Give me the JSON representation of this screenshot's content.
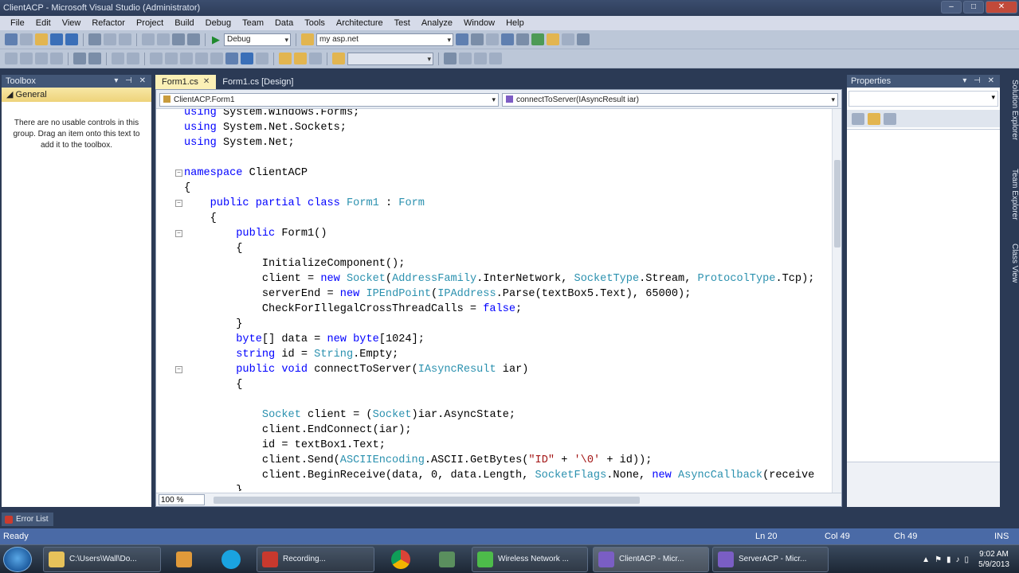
{
  "window": {
    "title": "ClientACP - Microsoft Visual Studio (Administrator)"
  },
  "menu": [
    "File",
    "Edit",
    "View",
    "Refactor",
    "Project",
    "Build",
    "Debug",
    "Team",
    "Data",
    "Tools",
    "Architecture",
    "Test",
    "Analyze",
    "Window",
    "Help"
  ],
  "toolbar": {
    "config": "Debug",
    "search": "my asp.net"
  },
  "toolbox": {
    "title": "Toolbox",
    "group": "General",
    "message": "There are no usable controls in this group. Drag an item onto this text to add it to the toolbox."
  },
  "tabs": [
    {
      "label": "Form1.cs",
      "active": true
    },
    {
      "label": "Form1.cs [Design]",
      "active": false
    }
  ],
  "nav": {
    "type": "ClientACP.Form1",
    "member": "connectToServer(IAsyncResult iar)"
  },
  "code": {
    "lines": [
      "using System.Windows.Forms;",
      "using System.Net.Sockets;",
      "using System.Net;",
      "",
      "namespace ClientACP",
      "{",
      "    public partial class Form1 : Form",
      "    {",
      "        public Form1()",
      "        {",
      "            InitializeComponent();",
      "            client = new Socket(AddressFamily.InterNetwork, SocketType.Stream, ProtocolType.Tcp);",
      "            serverEnd = new IPEndPoint(IPAddress.Parse(textBox5.Text), 65000);",
      "            CheckForIllegalCrossThreadCalls = false;",
      "        }",
      "        byte[] data = new byte[1024];",
      "        string id = String.Empty;",
      "        public void connectToServer(IAsyncResult iar)",
      "        {",
      "",
      "            Socket client = (Socket)iar.AsyncState;",
      "            client.EndConnect(iar);",
      "            id = textBox1.Text;",
      "            client.Send(ASCIIEncoding.ASCII.GetBytes(\"ID\" + '\\0' + id));",
      "            client.BeginReceive(data, 0, data.Length, SocketFlags.None, new AsyncCallback(receive",
      "        }"
    ]
  },
  "zoom": "100 %",
  "properties": {
    "title": "Properties"
  },
  "sidetabs": [
    "Solution Explorer",
    "Team Explorer",
    "Class View"
  ],
  "error_list": "Error List",
  "status": {
    "left": "Ready",
    "ln": "Ln 20",
    "col": "Col 49",
    "ch": "Ch 49",
    "mode": "INS"
  },
  "taskbar": {
    "items": [
      "C:\\Users\\Wall\\Do...",
      "Recording...",
      "Wireless Network ...",
      "ClientACP - Micr...",
      "ServerACP - Micr..."
    ],
    "time": "9:02 AM",
    "date": "5/9/2013"
  },
  "colors": {
    "keyword": "#0000ff",
    "type": "#2b91af",
    "string": "#a31515",
    "status": "#4a6aa6"
  }
}
